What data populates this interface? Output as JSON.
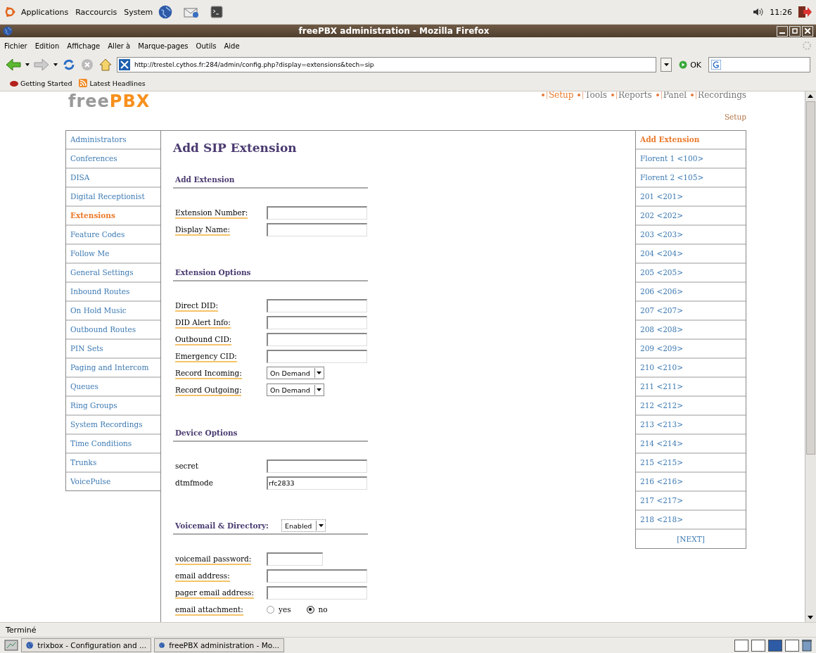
{
  "desktop_panel": {
    "menus": [
      "Applications",
      "Raccourcis",
      "System"
    ],
    "clock": "11:26"
  },
  "window": {
    "title": "freePBX administration - Mozilla Firefox"
  },
  "menu_bar": [
    "Fichier",
    "Edition",
    "Affichage",
    "Aller à",
    "Marque-pages",
    "Outils",
    "Aide"
  ],
  "toolbar": {
    "url": "http://trestel.cythos.fr:284/admin/config.php?display=extensions&tech=sip",
    "go_label": "OK"
  },
  "bookmarks": [
    "Getting Started",
    "Latest Headlines"
  ],
  "page": {
    "logo": [
      "free",
      "PBX"
    ],
    "nav": [
      {
        "label": "Setup",
        "selected": true
      },
      {
        "label": "Tools",
        "selected": false
      },
      {
        "label": "Reports",
        "selected": false
      },
      {
        "label": "Panel",
        "selected": false
      },
      {
        "label": "Recordings",
        "selected": false
      }
    ],
    "breadcrumb": "Setup",
    "sidebar": [
      {
        "label": "Administrators",
        "selected": false
      },
      {
        "label": "Conferences",
        "selected": false
      },
      {
        "label": "DISA",
        "selected": false
      },
      {
        "label": "Digital Receptionist",
        "selected": false
      },
      {
        "label": "Extensions",
        "selected": true
      },
      {
        "label": "Feature Codes",
        "selected": false
      },
      {
        "label": "Follow Me",
        "selected": false
      },
      {
        "label": "General Settings",
        "selected": false
      },
      {
        "label": "Inbound Routes",
        "selected": false
      },
      {
        "label": "On Hold Music",
        "selected": false
      },
      {
        "label": "Outbound Routes",
        "selected": false
      },
      {
        "label": "PIN Sets",
        "selected": false
      },
      {
        "label": "Paging and Intercom",
        "selected": false
      },
      {
        "label": "Queues",
        "selected": false
      },
      {
        "label": "Ring Groups",
        "selected": false
      },
      {
        "label": "System Recordings",
        "selected": false
      },
      {
        "label": "Time Conditions",
        "selected": false
      },
      {
        "label": "Trunks",
        "selected": false
      },
      {
        "label": "VoicePulse",
        "selected": false
      }
    ],
    "heading": "Add SIP Extension",
    "sections": [
      {
        "title": "Add Extension",
        "fields": [
          {
            "kind": "text",
            "label": "Extension Number:",
            "help": true
          },
          {
            "kind": "text",
            "label": "Display Name:",
            "help": true
          }
        ]
      },
      {
        "title": "Extension Options",
        "fields": [
          {
            "kind": "text",
            "label": "Direct DID:",
            "help": true
          },
          {
            "kind": "text",
            "label": "DID Alert Info:",
            "help": true
          },
          {
            "kind": "text",
            "label": "Outbound CID:",
            "help": true
          },
          {
            "kind": "text",
            "label": "Emergency CID:",
            "help": true
          },
          {
            "kind": "select",
            "label": "Record Incoming:",
            "value": "On Demand",
            "help": true
          },
          {
            "kind": "select",
            "label": "Record Outgoing:",
            "value": "On Demand",
            "help": true
          }
        ]
      },
      {
        "title": "Device Options",
        "fields": [
          {
            "kind": "text",
            "label": "secret",
            "help": false
          },
          {
            "kind": "text",
            "label": "dtmfmode",
            "value": "rfc2833",
            "help": false
          }
        ]
      },
      {
        "title": "Voicemail & Directory:",
        "select": "Enabled",
        "fields": [
          {
            "kind": "short",
            "label": "voicemail password:",
            "help": true
          },
          {
            "kind": "text",
            "label": "email address:",
            "help": true
          },
          {
            "kind": "text",
            "label": "pager email address:",
            "help": true
          },
          {
            "kind": "radio",
            "label": "email attachment:",
            "help": true,
            "options": [
              {
                "label": "yes",
                "selected": false
              },
              {
                "label": "no",
                "selected": true
              }
            ]
          }
        ]
      }
    ],
    "extensions": [
      {
        "label": "Add Extension",
        "selected": true
      },
      {
        "label": "Florent 1 <100>",
        "selected": false
      },
      {
        "label": "Florent 2 <105>",
        "selected": false
      },
      {
        "label": "201 <201>",
        "selected": false
      },
      {
        "label": "202 <202>",
        "selected": false
      },
      {
        "label": "203 <203>",
        "selected": false
      },
      {
        "label": "204 <204>",
        "selected": false
      },
      {
        "label": "205 <205>",
        "selected": false
      },
      {
        "label": "206 <206>",
        "selected": false
      },
      {
        "label": "207 <207>",
        "selected": false
      },
      {
        "label": "208 <208>",
        "selected": false
      },
      {
        "label": "209 <209>",
        "selected": false
      },
      {
        "label": "210 <210>",
        "selected": false
      },
      {
        "label": "211 <211>",
        "selected": false
      },
      {
        "label": "212 <212>",
        "selected": false
      },
      {
        "label": "213 <213>",
        "selected": false
      },
      {
        "label": "214 <214>",
        "selected": false
      },
      {
        "label": "215 <215>",
        "selected": false
      },
      {
        "label": "216 <216>",
        "selected": false
      },
      {
        "label": "217 <217>",
        "selected": false
      },
      {
        "label": "218 <218>",
        "selected": false
      }
    ],
    "next_link": "[NEXT]"
  },
  "status_bar": "Terminé",
  "taskbar": [
    "trixbox - Configuration and ...",
    "freePBX administration - Mo..."
  ]
}
